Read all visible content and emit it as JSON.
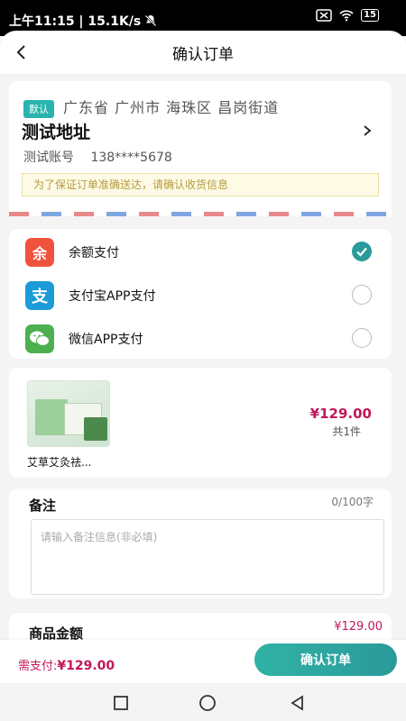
{
  "status_bar": {
    "time_speed": "上午11:15 | 15.1K/s",
    "battery": "15"
  },
  "nav": {
    "title": "确认订单"
  },
  "address": {
    "default_badge": "默认",
    "region": "广东省 广州市 海珠区 昌岗街道",
    "name": "测试地址",
    "contact_name": "测试账号",
    "phone": "138****5678",
    "notice": "为了保证订单准确送达，请确认收货信息"
  },
  "payment": {
    "options": [
      {
        "label": "余额支付",
        "icon": "balance-icon",
        "icon_text": "余",
        "color": "#f0533d",
        "selected": true
      },
      {
        "label": "支付宝APP支付",
        "icon": "alipay-icon",
        "icon_text": "支",
        "color": "#1c9bd8",
        "selected": false
      },
      {
        "label": "微信APP支付",
        "icon": "wechat-icon",
        "icon_text": "",
        "color": "#4caf50",
        "selected": false
      }
    ]
  },
  "product": {
    "name": "艾草艾灸祛...",
    "price": "¥129.00",
    "quantity": "共1件"
  },
  "remark": {
    "title": "备注",
    "count": "0/100字",
    "placeholder": "请输入备注信息(非必填)"
  },
  "amount": {
    "label": "商品金额",
    "value": "¥129.00"
  },
  "bottom_bar": {
    "need_pay_label": "需支付:",
    "need_pay_value": "¥129.00",
    "confirm_label": "确认订单"
  },
  "colors": {
    "accent": "#2a9a9a",
    "price": "#c2185b",
    "badge": "#2ab3ae"
  }
}
